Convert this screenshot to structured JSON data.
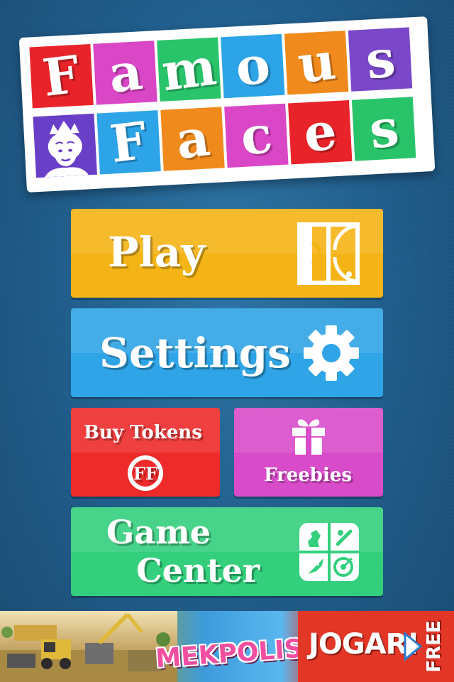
{
  "logo": {
    "row1": [
      {
        "letter": "F",
        "color": "#e8232a"
      },
      {
        "letter": "a",
        "color": "#d946c6"
      },
      {
        "letter": "m",
        "color": "#29c36a"
      },
      {
        "letter": "o",
        "color": "#2ea4e8"
      },
      {
        "letter": "u",
        "color": "#f08a1c"
      },
      {
        "letter": "s",
        "color": "#7a47c9"
      }
    ],
    "row2": [
      {
        "letter": "F",
        "color": "#2ea4e8"
      },
      {
        "letter": "a",
        "color": "#f08a1c"
      },
      {
        "letter": "c",
        "color": "#d946c6"
      },
      {
        "letter": "e",
        "color": "#e8232a"
      },
      {
        "letter": "s",
        "color": "#29c36a"
      }
    ],
    "face_tile_color": "#6a3fc8"
  },
  "menu": {
    "play": {
      "label": "Play",
      "icon": "court-icon"
    },
    "settings": {
      "label": "Settings",
      "icon": "gear-icon"
    },
    "buy_tokens": {
      "label": "Buy Tokens",
      "icon": "token-icon",
      "token_text": "FF"
    },
    "freebies": {
      "label": "Freebies",
      "icon": "gift-icon"
    },
    "game_center": {
      "label_line1": "Game",
      "label_line2": "Center",
      "icon": "game-center-icon"
    }
  },
  "ad": {
    "brand": "MEKPOLIS",
    "cta": "JOGAR!",
    "badge": "FREE"
  }
}
